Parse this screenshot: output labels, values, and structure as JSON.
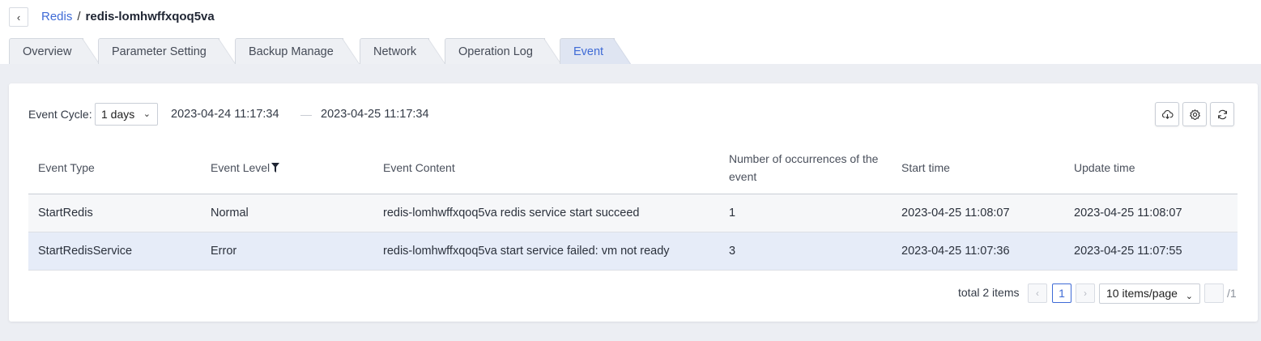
{
  "breadcrumb": {
    "parent": "Redis",
    "separator": "/",
    "current": "redis-lomhwffxqoq5va"
  },
  "tabs": [
    {
      "label": "Overview"
    },
    {
      "label": "Parameter Setting"
    },
    {
      "label": "Backup Manage"
    },
    {
      "label": "Network"
    },
    {
      "label": "Operation Log"
    },
    {
      "label": "Event",
      "active": true
    }
  ],
  "toolbar": {
    "cycle_label": "Event Cycle:",
    "cycle_value": "1 days",
    "date_start": "2023-04-24 11:17:34",
    "date_separator": "—",
    "date_end": "2023-04-25 11:17:34",
    "icons": [
      "cloud-download-icon",
      "gear-icon",
      "refresh-icon"
    ]
  },
  "table": {
    "columns": [
      "Event Type",
      "Event Level",
      "Event Content",
      "Number of occurrences of the event",
      "Start time",
      "Update time"
    ],
    "rows": [
      [
        "StartRedis",
        "Normal",
        "redis-lomhwffxqoq5va redis service start succeed",
        "1",
        "2023-04-25 11:08:07",
        "2023-04-25 11:08:07"
      ],
      [
        "StartRedisService",
        "Error",
        "redis-lomhwffxqoq5va start service failed: vm not ready",
        "3",
        "2023-04-25 11:07:36",
        "2023-04-25 11:07:55"
      ]
    ]
  },
  "pagination": {
    "total": "total 2 items",
    "prev": "‹",
    "current_page": "1",
    "next": "›",
    "page_size": "10 items/page",
    "page_count": "/1"
  },
  "colors": {
    "accent": "#3f6bd6",
    "selected_row": "#e6ecf8",
    "page_bg": "#eceef3"
  }
}
